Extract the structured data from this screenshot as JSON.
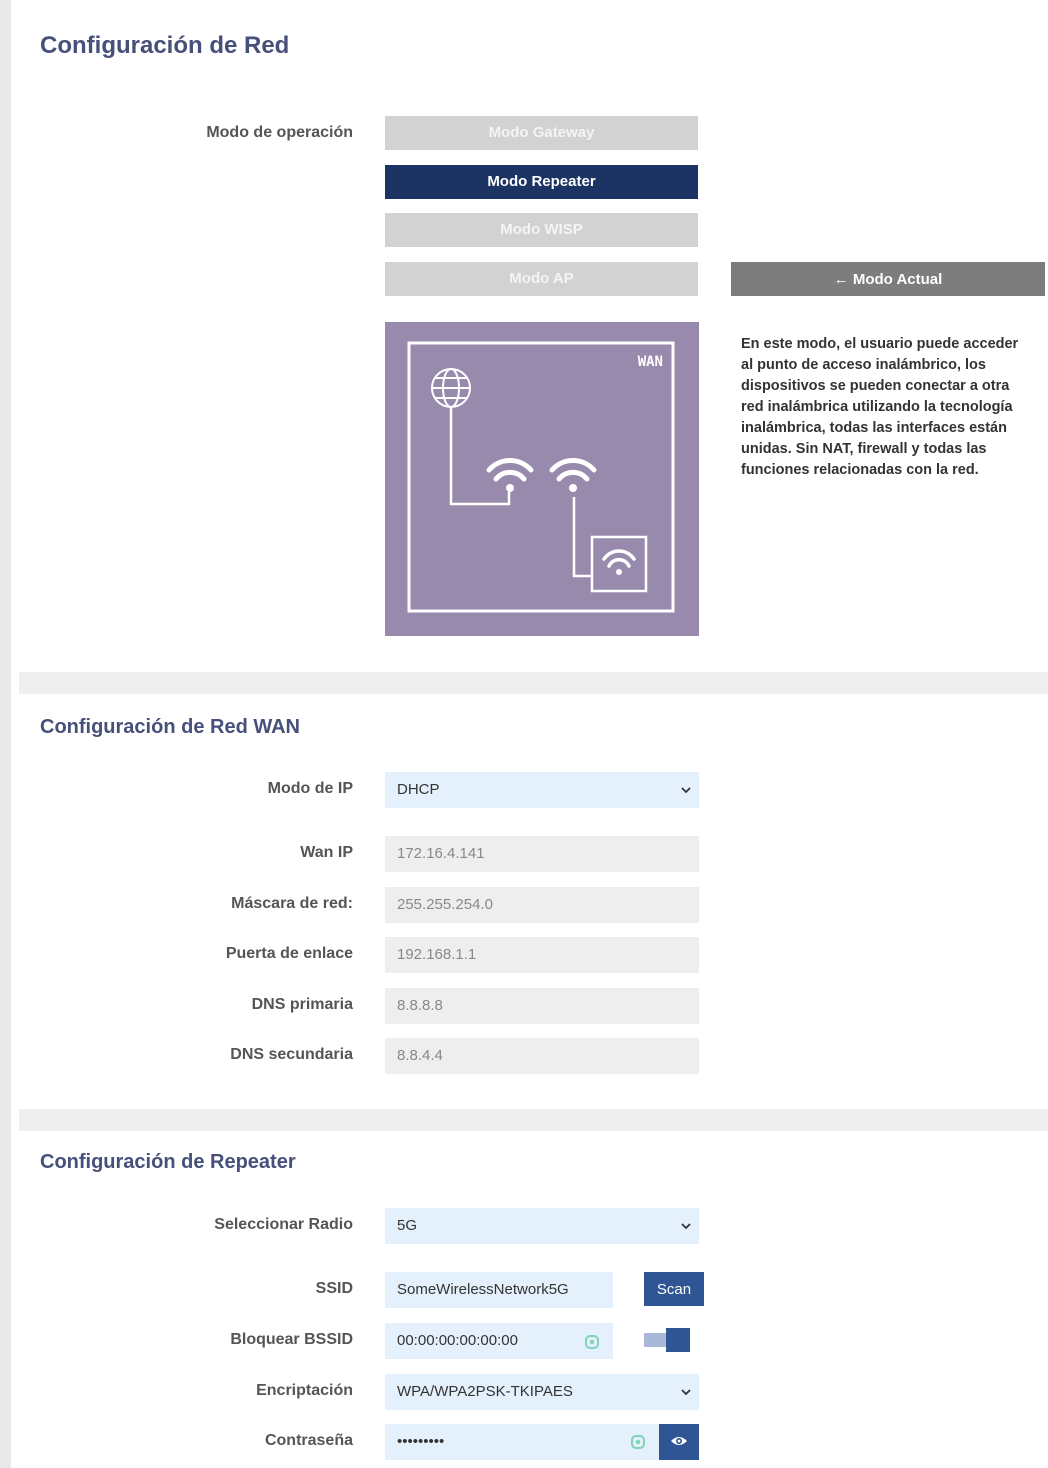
{
  "network_config": {
    "title": "Configuración de Red",
    "mode_label": "Modo de operación",
    "modes": [
      {
        "label": "Modo Gateway",
        "active": false
      },
      {
        "label": "Modo Repeater",
        "active": true
      },
      {
        "label": "Modo WISP",
        "active": false
      },
      {
        "label": "Modo AP",
        "active": false
      }
    ],
    "current_mode_label": "← Modo Actual",
    "diagram_wan_label": "WAN",
    "description": "En este modo, el usuario puede acceder al punto de acceso inalámbrico, los dispositivos se pueden conectar a otra red inalámbrica utilizando la tecnología inalámbrica, todas las interfaces están unidas. Sin NAT, firewall y todas las funciones relacionadas con la red."
  },
  "wan": {
    "title": "Configuración de Red WAN",
    "ip_mode_label": "Modo de IP",
    "ip_mode_value": "DHCP",
    "wan_ip_label": "Wan IP",
    "wan_ip_value": "172.16.4.141",
    "netmask_label": "Máscara de red:",
    "netmask_value": "255.255.254.0",
    "gateway_label": "Puerta de enlace",
    "gateway_value": "192.168.1.1",
    "dns1_label": "DNS primaria",
    "dns1_value": "8.8.8.8",
    "dns2_label": "DNS secundaria",
    "dns2_value": "8.8.4.4"
  },
  "repeater": {
    "title": "Configuración de Repeater",
    "radio_label": "Seleccionar Radio",
    "radio_value": "5G",
    "ssid_label": "SSID",
    "ssid_value": "SomeWirelessNetwork5G",
    "scan_label": "Scan",
    "bssid_label": "Bloquear BSSID",
    "bssid_value": "00:00:00:00:00:00",
    "bssid_lock_enabled": true,
    "encryption_label": "Encriptación",
    "encryption_value": "WPA/WPA2PSK-TKIPAES",
    "password_label": "Contraseña",
    "password_value": "•••••••••"
  },
  "colors": {
    "title": "#46507a",
    "active_mode": "#1b3464",
    "inactive_mode": "#d2d2d2",
    "diagram_bg": "#978aad",
    "button_blue": "#2f5595",
    "input_editable": "#e4f0fb",
    "input_readonly": "#eeeeee"
  }
}
